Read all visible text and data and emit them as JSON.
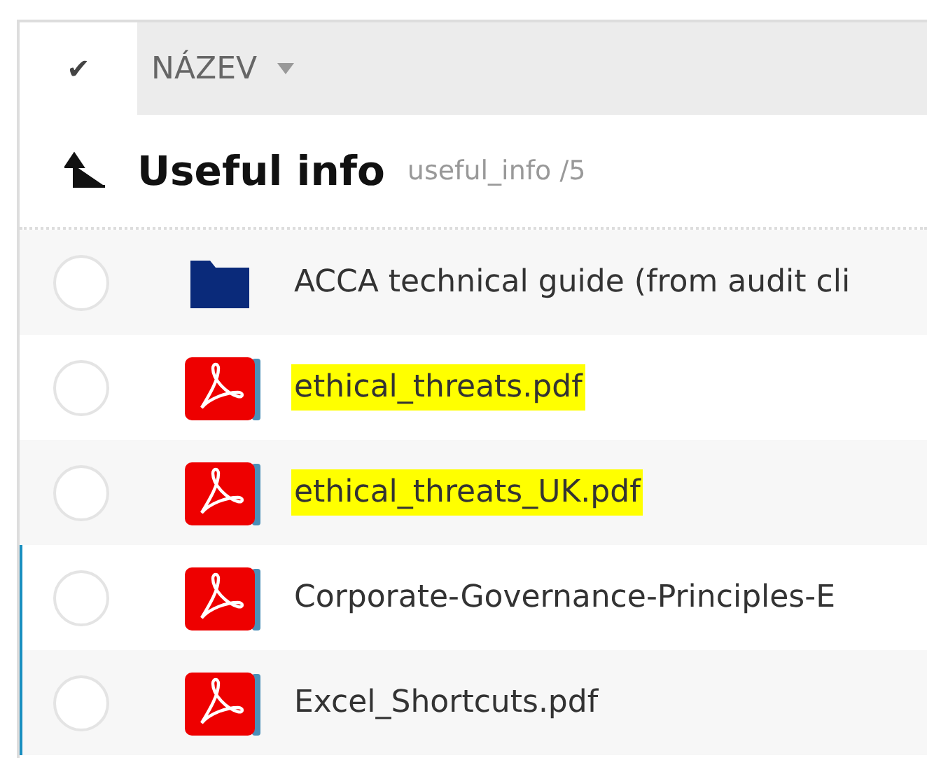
{
  "header": {
    "check_symbol": "✔",
    "column": "NÁZEV"
  },
  "folder": {
    "title": "Useful info",
    "path": "useful_info /5"
  },
  "rows": [
    {
      "kind": "folder",
      "name": "ACCA technical guide (from audit cli",
      "selected": false,
      "highlighted": false,
      "marked": false
    },
    {
      "kind": "pdf",
      "name": "ethical_threats.pdf",
      "selected": false,
      "highlighted": true,
      "marked": false
    },
    {
      "kind": "pdf",
      "name": "ethical_threats_UK.pdf",
      "selected": false,
      "highlighted": true,
      "marked": false
    },
    {
      "kind": "pdf",
      "name": "Corporate-Governance-Principles-E",
      "selected": false,
      "highlighted": false,
      "marked": true
    },
    {
      "kind": "pdf",
      "name": "Excel_Shortcuts.pdf",
      "selected": false,
      "highlighted": false,
      "marked": true
    }
  ]
}
